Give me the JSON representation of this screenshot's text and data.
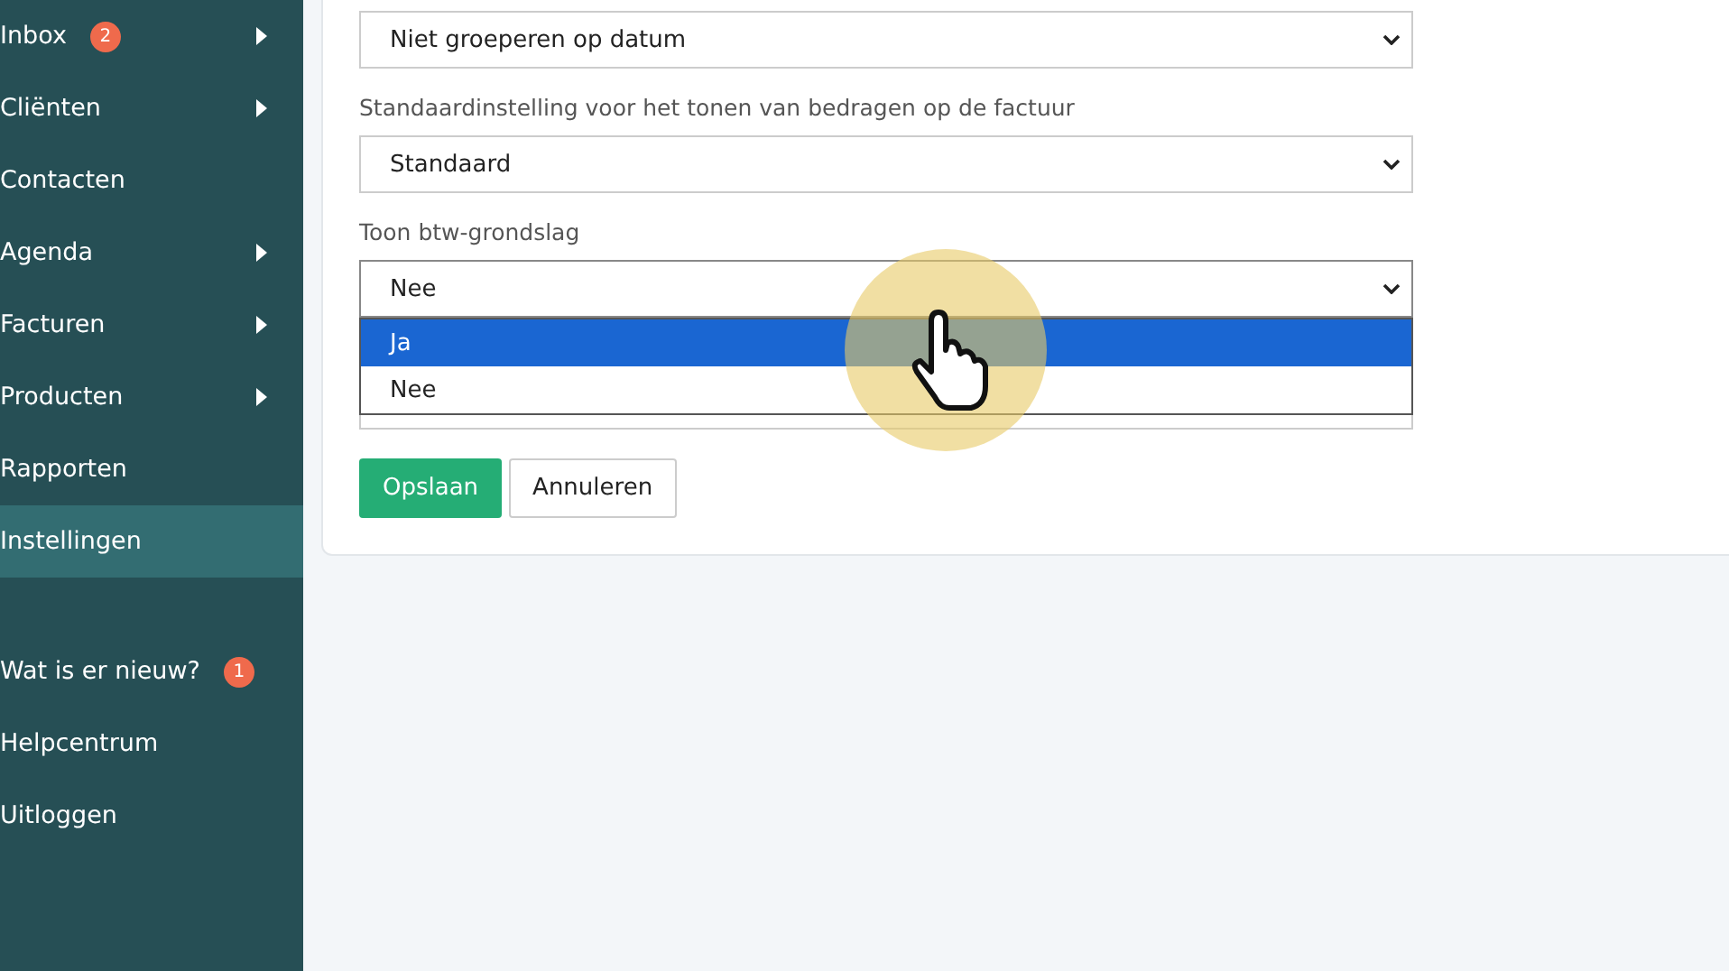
{
  "sidebar": {
    "items": [
      {
        "label": "Inbox",
        "badge": "2",
        "has_submenu": true,
        "selected": false
      },
      {
        "label": "Cliënten",
        "has_submenu": true,
        "selected": false
      },
      {
        "label": "Contacten",
        "has_submenu": false,
        "selected": false
      },
      {
        "label": "Agenda",
        "has_submenu": true,
        "selected": false
      },
      {
        "label": "Facturen",
        "has_submenu": true,
        "selected": false
      },
      {
        "label": "Producten",
        "has_submenu": true,
        "selected": false
      },
      {
        "label": "Rapporten",
        "has_submenu": false,
        "selected": false
      },
      {
        "label": "Instellingen",
        "has_submenu": false,
        "selected": true
      }
    ],
    "secondary_items": [
      {
        "label": "Wat is er nieuw?",
        "badge": "1"
      },
      {
        "label": "Helpcentrum"
      },
      {
        "label": "Uitloggen"
      }
    ]
  },
  "form": {
    "fields": [
      {
        "value": "Niet groeperen op datum",
        "open": false
      },
      {
        "label": "Standaardinstelling voor het tonen van bedragen op de factuur",
        "value": "Standaard",
        "open": false
      },
      {
        "label": "Toon btw-grondslag",
        "value": "Nee",
        "open": true,
        "options": [
          {
            "label": "Ja",
            "highlighted": true
          },
          {
            "label": "Nee",
            "highlighted": false
          }
        ]
      },
      {
        "open": false
      }
    ],
    "buttons": [
      {
        "label": "Opslaan",
        "kind": "primary"
      },
      {
        "label": "Annuleren",
        "kind": "secondary"
      }
    ]
  }
}
